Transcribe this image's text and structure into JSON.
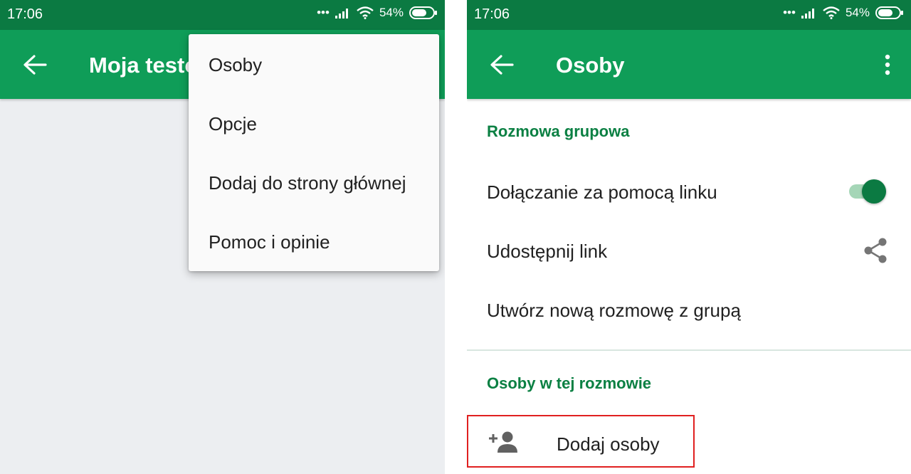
{
  "left": {
    "status": {
      "time": "17:06",
      "battery": "54%"
    },
    "appbar": {
      "title": "Moja testowa"
    },
    "menu": {
      "items": [
        {
          "label": "Osoby"
        },
        {
          "label": "Opcje"
        },
        {
          "label": "Dodaj do strony głównej"
        },
        {
          "label": "Pomoc i opinie"
        }
      ]
    }
  },
  "right": {
    "status": {
      "time": "17:06",
      "battery": "54%"
    },
    "appbar": {
      "title": "Osoby"
    },
    "group_section": {
      "title": "Rozmowa grupowa",
      "join_by_link": {
        "label": "Dołączanie za pomocą linku",
        "enabled": true
      },
      "share_link": {
        "label": "Udostępnij link"
      },
      "new_group": {
        "label": "Utwórz nową rozmowę z grupą"
      }
    },
    "people_section": {
      "title": "Osoby w tej rozmowie",
      "add_people": {
        "label": "Dodaj osoby"
      }
    }
  },
  "colors": {
    "status_bar": "#0b7a42",
    "app_bar": "#0f9d58",
    "section_title": "#0b8043",
    "highlight_box": "#e02020"
  },
  "icons": [
    "back-arrow-icon",
    "more-vert-icon",
    "share-icon",
    "person-add-icon",
    "wifi-icon",
    "signal-icon",
    "battery-icon"
  ]
}
